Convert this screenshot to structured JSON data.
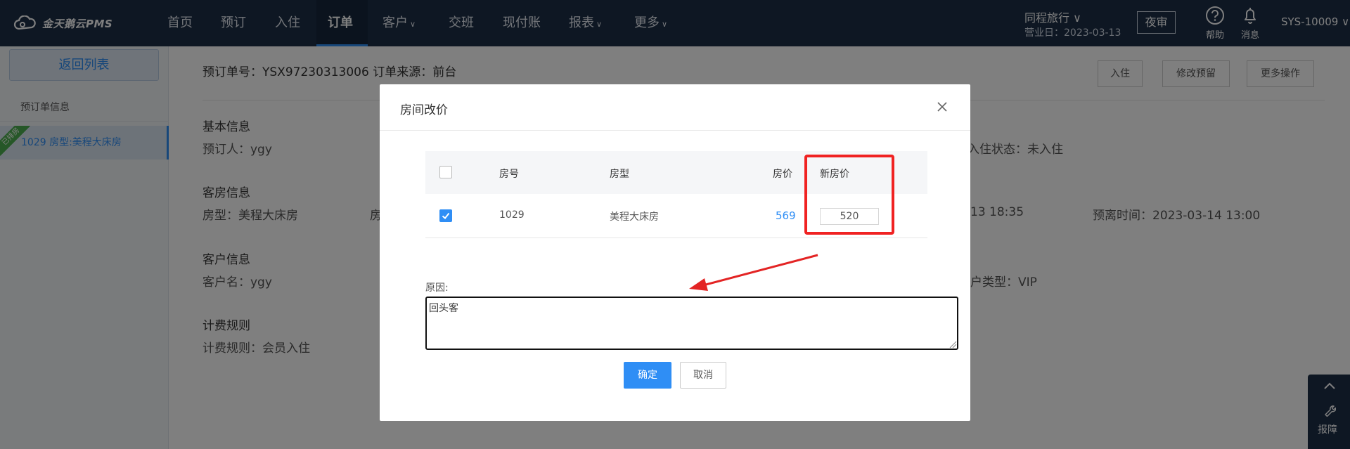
{
  "app": {
    "logo_text": "金天鹅云PMS"
  },
  "nav": {
    "items": [
      {
        "label": "首页",
        "caret": ""
      },
      {
        "label": "预订",
        "caret": ""
      },
      {
        "label": "入住",
        "caret": ""
      },
      {
        "label": "订单",
        "caret": ""
      },
      {
        "label": "客户",
        "caret": "∨"
      },
      {
        "label": "交班",
        "caret": ""
      },
      {
        "label": "现付账",
        "caret": ""
      },
      {
        "label": "报表",
        "caret": "∨"
      },
      {
        "label": "更多",
        "caret": "∨"
      }
    ],
    "active_index": 3
  },
  "header_right": {
    "hotel": "同程旅行 ∨",
    "business_day": "营业日：2023-03-13",
    "night_audit": "夜审",
    "help": "帮助",
    "messages": "消息",
    "user": "SYS-10009 ∨"
  },
  "sidebar": {
    "back_label": "返回列表",
    "section_label": "预订单信息",
    "ribbon": "已排房",
    "room_item": "1029 房型:美程大床房"
  },
  "main": {
    "order_line": "预订单号：YSX97230313006  订单来源：前台",
    "actions": [
      "入住",
      "修改预留",
      "更多操作"
    ],
    "sections": {
      "basic": "基本信息",
      "room": "客房信息",
      "guest": "客户信息",
      "billing": "计费规则"
    },
    "fields": {
      "booker": "预订人：ygy",
      "checkin_status": "入住状态：未入住",
      "room_type": "房型：美程大床房",
      "room_prefix": "房",
      "arrival_partial": "13 18:35",
      "departure": "预离时间：2023-03-14 13:00",
      "guest_name": "客户名：ygy",
      "guest_type": "户类型：VIP",
      "billing_rule": "计费规则：会员入住"
    }
  },
  "modal": {
    "title": "房间改价",
    "table": {
      "headers": [
        "房号",
        "房型",
        "房价",
        "新房价"
      ],
      "rows": [
        {
          "room_no": "1029",
          "room_type": "美程大床房",
          "price": "569",
          "new_price": "520",
          "checked": true
        }
      ]
    },
    "reason_label": "原因:",
    "reason_value": "回头客",
    "confirm": "确定",
    "cancel": "取消"
  },
  "float_panel": {
    "label": "报障"
  },
  "colors": {
    "nav_bg": "#1c2f47",
    "accent": "#2f8ef5",
    "highlight": "#f02222"
  }
}
